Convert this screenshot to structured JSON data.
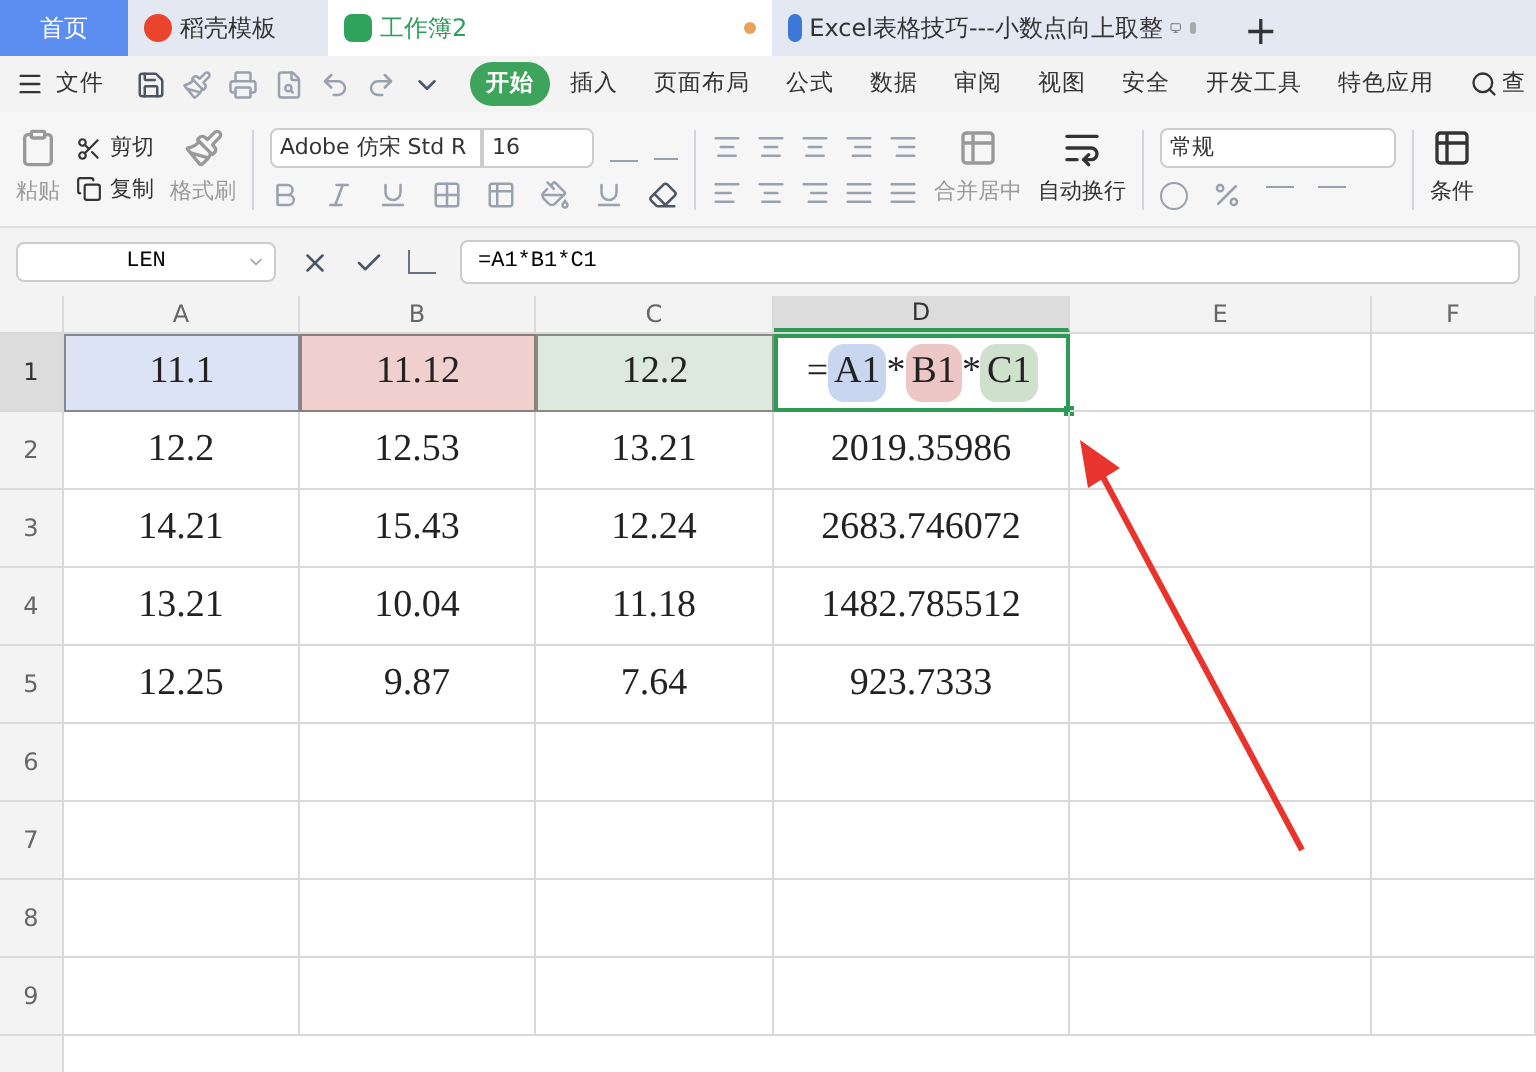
{
  "tabs": [
    {
      "label": "首页",
      "kind": "home",
      "selected": false
    },
    {
      "label": "稻壳模板",
      "kind": "template",
      "selected": false
    },
    {
      "label": "工作簿2",
      "kind": "sheet",
      "selected": true,
      "modified": true
    },
    {
      "label": "Excel表格技巧---小数点向上取整",
      "kind": "doc",
      "selected": false,
      "modified": true
    }
  ],
  "new_tab": "+",
  "menu": {
    "file": "文件",
    "items": [
      {
        "label": "开始",
        "selected": true
      },
      {
        "label": "插入",
        "selected": false
      },
      {
        "label": "页面布局",
        "selected": false
      },
      {
        "label": "公式",
        "selected": false
      },
      {
        "label": "数据",
        "selected": false
      },
      {
        "label": "审阅",
        "selected": false
      },
      {
        "label": "视图",
        "selected": false
      },
      {
        "label": "安全",
        "selected": false
      },
      {
        "label": "开发工具",
        "selected": false
      },
      {
        "label": "特色应用",
        "selected": false
      }
    ],
    "search": "查"
  },
  "toolbar": {
    "paste": "粘贴",
    "cut": "剪切",
    "copy": "复制",
    "format_painter": "格式刷",
    "font": "Adobe 仿宋 Std R",
    "font_size": "16",
    "merge": "合并居中",
    "wrap": "自动换行",
    "number_format": "常规",
    "conditional": "条件"
  },
  "formula_bar": {
    "name_box": "LEN",
    "formula": "=A1*B1*C1"
  },
  "columns": [
    {
      "label": "A",
      "selected": false
    },
    {
      "label": "B",
      "selected": false
    },
    {
      "label": "C",
      "selected": false
    },
    {
      "label": "D",
      "selected": true
    },
    {
      "label": "E",
      "selected": false
    },
    {
      "label": "F",
      "selected": false
    }
  ],
  "rows": [
    {
      "label": "1",
      "selected": true,
      "cells": [
        {
          "kind": "value",
          "text": "11.1",
          "color": "#dbe3f5",
          "selected": false
        },
        {
          "kind": "value",
          "text": "11.12",
          "color": "#efd0cf",
          "selected": false
        },
        {
          "kind": "value",
          "text": "12.2",
          "color": "#dde9dc",
          "selected": false
        },
        {
          "kind": "formula",
          "selected": true,
          "tokens": [
            {
              "kind": "op",
              "text": "="
            },
            {
              "kind": "ref",
              "text": "A1",
              "color": "#c9d6ef"
            },
            {
              "kind": "op",
              "text": "*"
            },
            {
              "kind": "ref",
              "text": "B1",
              "color": "#ecc7c6"
            },
            {
              "kind": "op",
              "text": "*"
            },
            {
              "kind": "ref",
              "text": "C1",
              "color": "#cfe0cd"
            }
          ]
        }
      ]
    },
    {
      "label": "2",
      "selected": false,
      "cells": [
        {
          "kind": "value",
          "text": "12.2",
          "selected": false
        },
        {
          "kind": "value",
          "text": "12.53",
          "selected": false
        },
        {
          "kind": "value",
          "text": "13.21",
          "selected": false
        },
        {
          "kind": "value",
          "text": "2019.35986",
          "selected": false
        }
      ]
    },
    {
      "label": "3",
      "selected": false,
      "cells": [
        {
          "kind": "value",
          "text": "14.21",
          "selected": false
        },
        {
          "kind": "value",
          "text": "15.43",
          "selected": false
        },
        {
          "kind": "value",
          "text": "12.24",
          "selected": false
        },
        {
          "kind": "value",
          "text": "2683.746072",
          "selected": false
        }
      ]
    },
    {
      "label": "4",
      "selected": false,
      "cells": [
        {
          "kind": "value",
          "text": "13.21",
          "selected": false
        },
        {
          "kind": "value",
          "text": "10.04",
          "selected": false
        },
        {
          "kind": "value",
          "text": "11.18",
          "selected": false
        },
        {
          "kind": "value",
          "text": "1482.785512",
          "selected": false
        }
      ]
    },
    {
      "label": "5",
      "selected": false,
      "cells": [
        {
          "kind": "value",
          "text": "12.25",
          "selected": false
        },
        {
          "kind": "value",
          "text": "9.87",
          "selected": false
        },
        {
          "kind": "value",
          "text": "7.64",
          "selected": false
        },
        {
          "kind": "value",
          "text": "923.7333",
          "selected": false
        }
      ]
    },
    {
      "label": "6",
      "selected": false,
      "cells": []
    },
    {
      "label": "7",
      "selected": false,
      "cells": []
    },
    {
      "label": "8",
      "selected": false,
      "cells": []
    },
    {
      "label": "9",
      "selected": false,
      "cells": []
    }
  ]
}
